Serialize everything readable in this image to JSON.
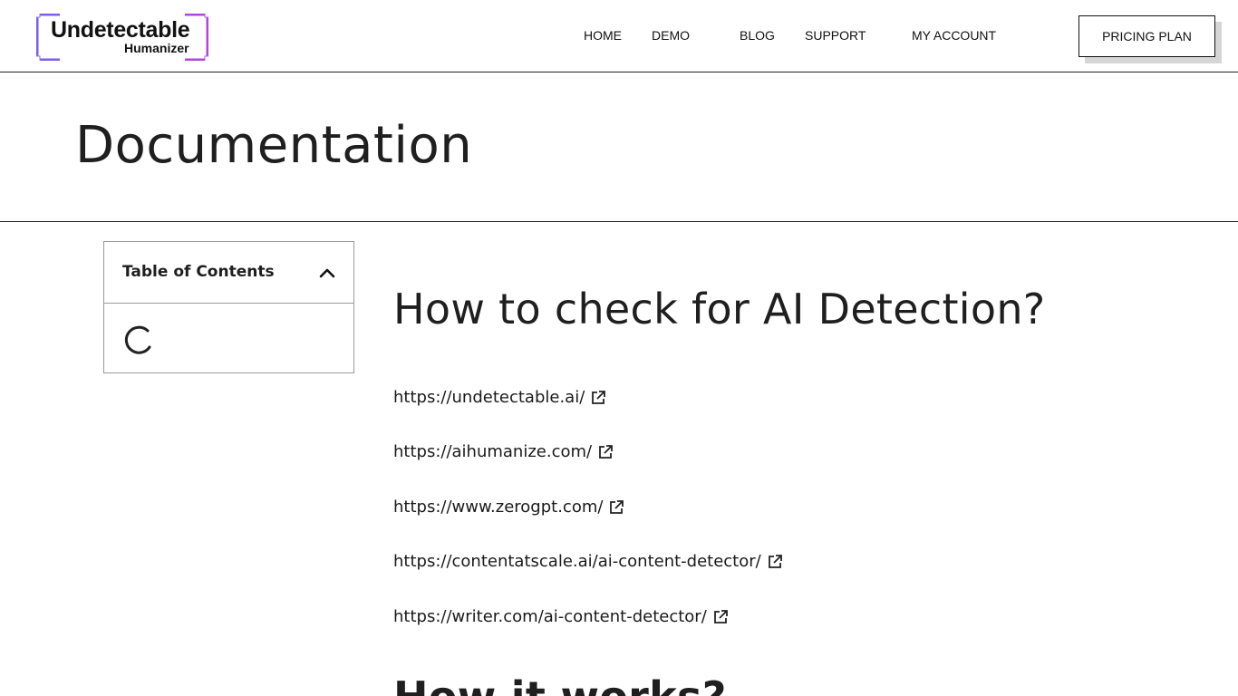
{
  "header": {
    "logo": {
      "line1": "Undetectable",
      "line2": "Humanizer"
    },
    "nav": [
      {
        "label": "HOME"
      },
      {
        "label": "DEMO"
      },
      {
        "label": "BLOG"
      },
      {
        "label": "SUPPORT"
      },
      {
        "label": "MY ACCOUNT"
      }
    ],
    "pricing_label": "PRICING PLAN"
  },
  "page": {
    "title": "Documentation"
  },
  "toc": {
    "title": "Table of Contents",
    "toggle_icon": "chevron-up-icon",
    "loading_icon": "spinner-icon"
  },
  "main": {
    "section1_title": "How to check for AI Detection?",
    "links": [
      {
        "text": "https://undetectable.ai/"
      },
      {
        "text": "https://aihumanize.com/"
      },
      {
        "text": "https://www.zerogpt.com/"
      },
      {
        "text": "https://contentatscale.ai/ai-content-detector/"
      },
      {
        "text": "https://writer.com/ai-content-detector/"
      }
    ],
    "section2_title": "How it works?"
  },
  "colors": {
    "logo_bracket_left": "#7a5cf0",
    "logo_bracket_right": "#b044e0",
    "text": "#1e1e1e",
    "border": "#9a9a9a"
  }
}
